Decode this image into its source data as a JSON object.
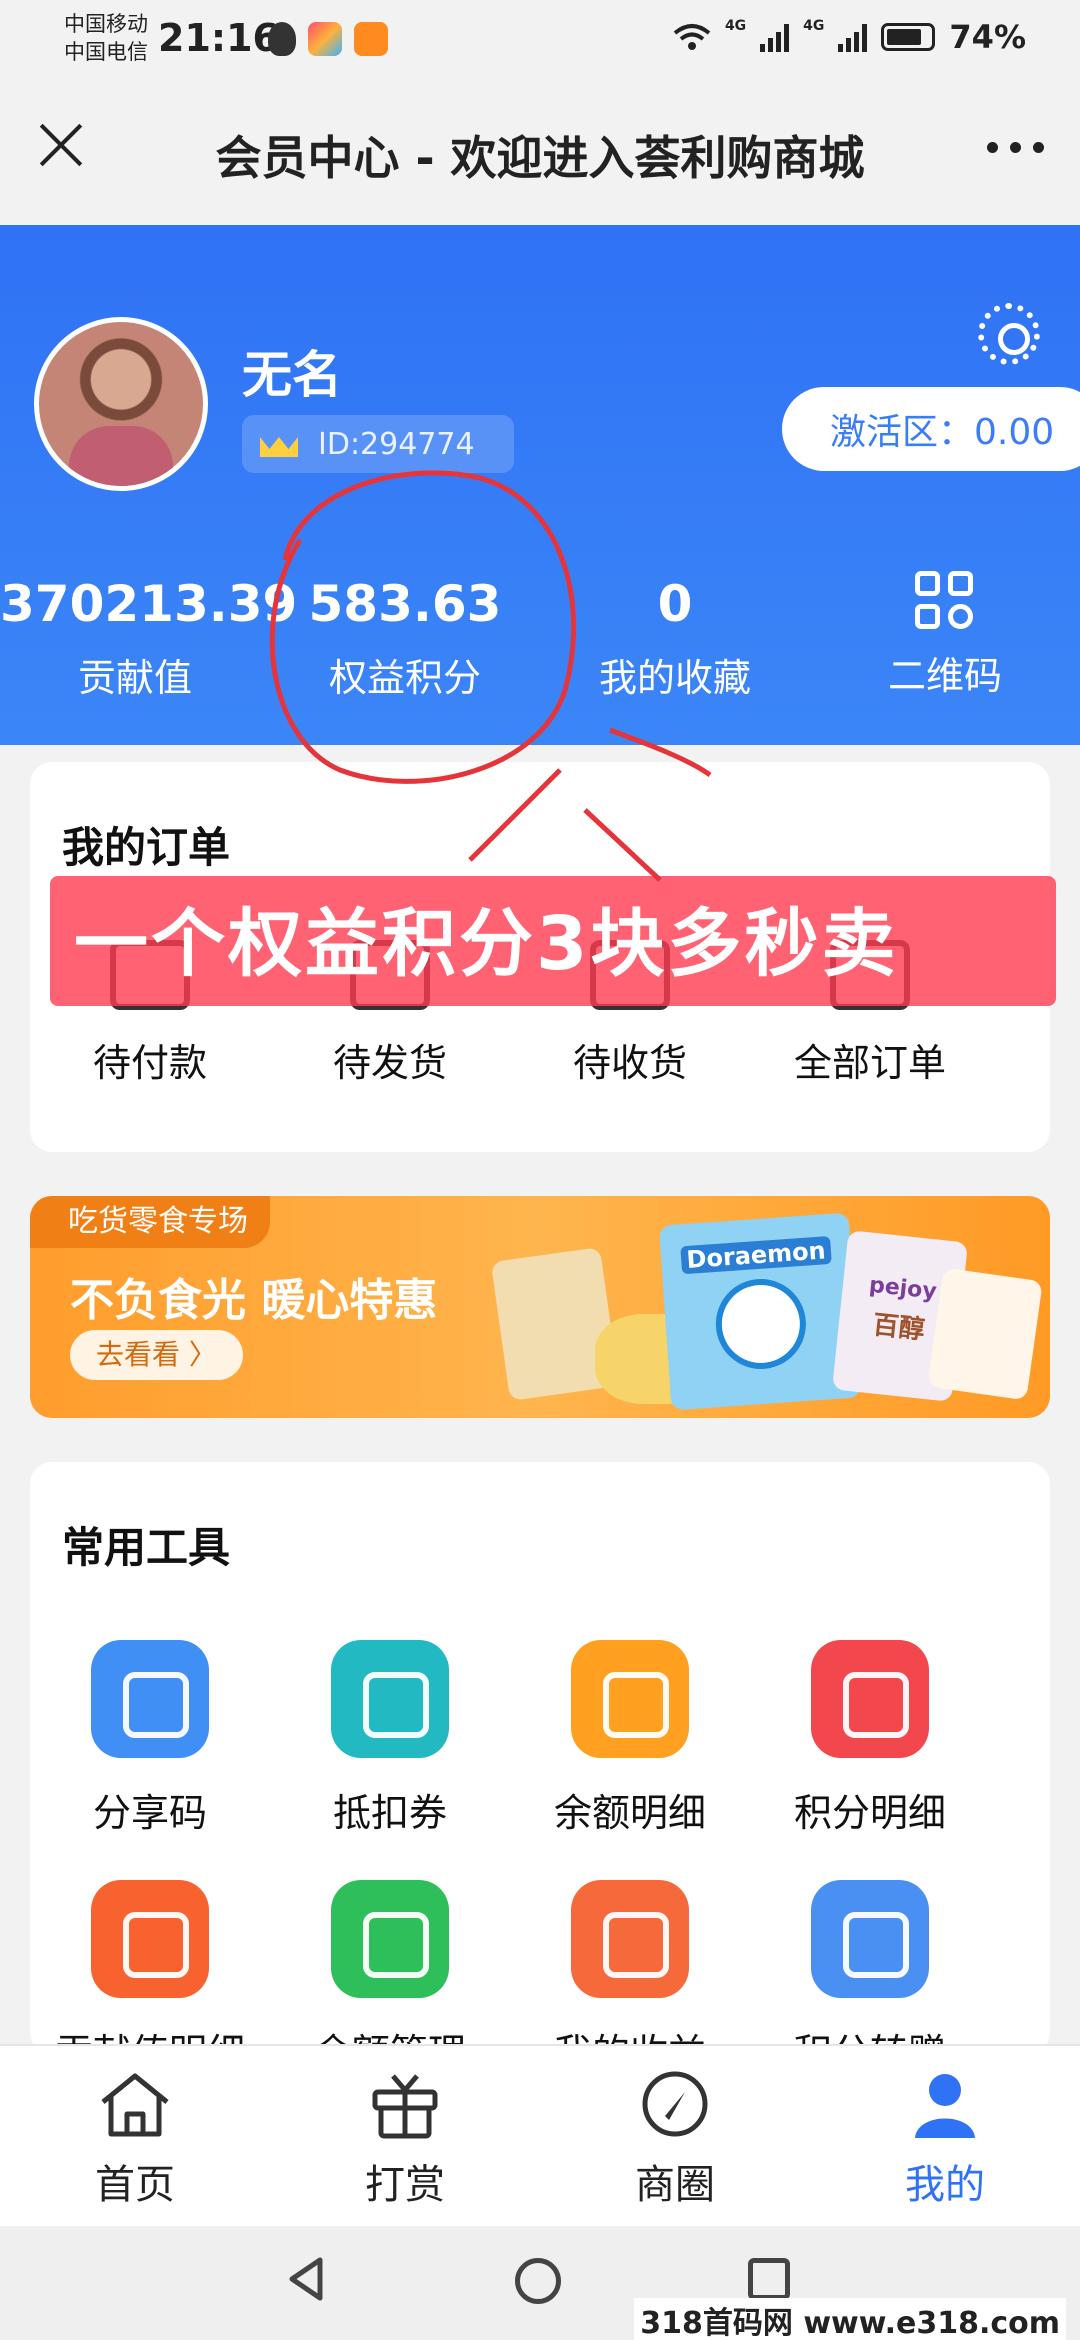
{
  "status_bar": {
    "carrier_1": "中国移动",
    "carrier_2": "中国电信",
    "time": "21:16",
    "network_1": "4G",
    "network_2": "4G",
    "battery": "74%"
  },
  "title_bar": {
    "title": "会员中心 - 欢迎进入荟利购商城"
  },
  "profile": {
    "name": "无名",
    "id": "ID:294774",
    "activate_label": "激活区：0.00"
  },
  "stats": [
    {
      "value": "370213.39",
      "label": "贡献值"
    },
    {
      "value": "583.63",
      "label": "权益积分"
    },
    {
      "value": "0",
      "label": "我的收藏"
    },
    {
      "label": "二维码",
      "icon": "qr-code-icon"
    }
  ],
  "orders": {
    "title": "我的订单",
    "items": [
      {
        "label": "待付款",
        "icon": "wallet-icon"
      },
      {
        "label": "待发货",
        "icon": "package-icon"
      },
      {
        "label": "待收货",
        "icon": "truck-icon"
      },
      {
        "label": "全部订单",
        "icon": "list-icon"
      }
    ]
  },
  "annotation": {
    "overlay_text": "一个权益积分3块多秒卖",
    "circle_color": "#e5353b"
  },
  "snack_banner": {
    "tag": "吃货零食专场",
    "headline": "不负食光 暖心特惠",
    "button": "去看看 〉",
    "product_text_1": "Doraemon",
    "product_text_2": "pejoy",
    "product_text_3": "百醇"
  },
  "tools": {
    "title": "常用工具",
    "items": [
      {
        "label": "分享码",
        "icon": "share-tv-icon",
        "color": "#3f8ff5"
      },
      {
        "label": "抵扣券",
        "icon": "coupon-icon",
        "color": "#22b9c3"
      },
      {
        "label": "余额明细",
        "icon": "money-bag-icon",
        "color": "#ffa020"
      },
      {
        "label": "积分明细",
        "icon": "star-badge-icon",
        "color": "#f2484d"
      },
      {
        "label": "贡献值明细",
        "icon": "tag-icon",
        "color": "#f7622f"
      },
      {
        "label": "余额管理",
        "icon": "wallet-icon",
        "color": "#2fbf5a"
      },
      {
        "label": "我的收益",
        "icon": "calendar-chart-icon",
        "color": "#f6693a"
      },
      {
        "label": "积分转赠",
        "icon": "gift-icon",
        "color": "#4a90f2"
      }
    ]
  },
  "bottom_nav": [
    {
      "label": "首页",
      "icon": "home-icon"
    },
    {
      "label": "打赏",
      "icon": "gift-box-icon"
    },
    {
      "label": "商圈",
      "icon": "compass-icon"
    },
    {
      "label": "我的",
      "icon": "user-icon",
      "active": true
    }
  ],
  "watermark": "318首码网  www.e318.com",
  "colors": {
    "primary": "#2f72f5",
    "promo_red": "#ff3c50",
    "snack_orange": "#ff9d2d"
  }
}
